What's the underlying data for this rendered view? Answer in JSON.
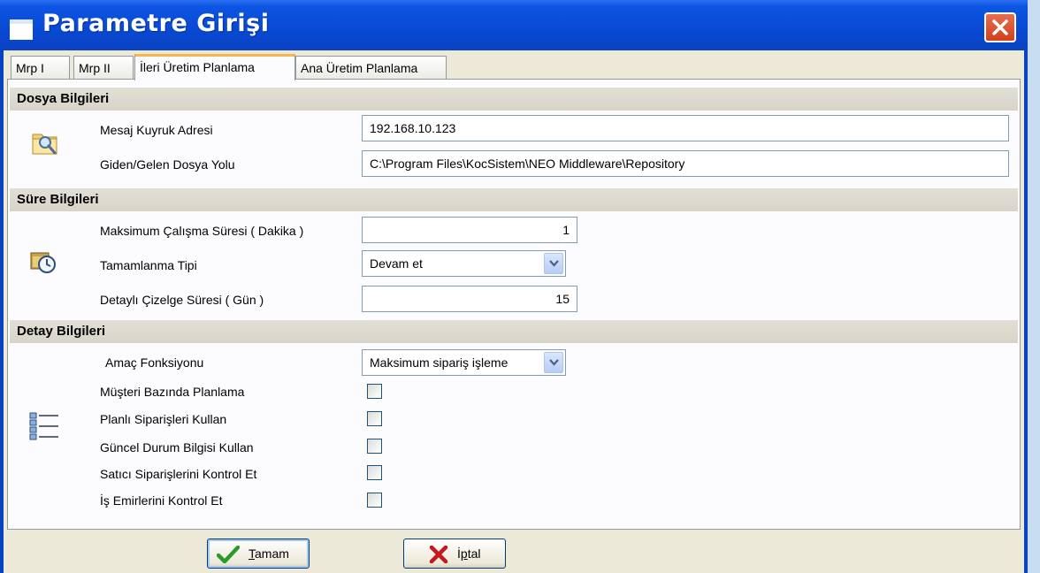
{
  "window": {
    "title": "Parametre Girişi"
  },
  "tabs": [
    "Mrp I",
    "Mrp II",
    "İleri Üretim Planlama",
    "Ana Üretim Planlama"
  ],
  "sections": {
    "dosya": {
      "title": "Dosya Bilgileri",
      "mesaj_label": "Mesaj Kuyruk Adresi",
      "mesaj_value": "192.168.10.123",
      "yol_label": "Giden/Gelen Dosya Yolu",
      "yol_value": "C:\\Program Files\\KocSistem\\NEO Middleware\\Repository"
    },
    "sure": {
      "title": "Süre Bilgileri",
      "maks_label": "Maksimum Çalışma Süresi ( Dakika )",
      "maks_value": "1",
      "tip_label": "Tamamlanma Tipi",
      "tip_value": "Devam et",
      "cizelge_label": "Detaylı Çizelge Süresi ( Gün )",
      "cizelge_value": "15"
    },
    "detay": {
      "title": "Detay Bilgileri",
      "amac_label": "Amaç Fonksiyonu",
      "amac_value": "Maksimum sipariş işleme",
      "checks": [
        "Müşteri Bazında Planlama",
        "Planlı Siparişleri Kullan",
        "Güncel Durum Bilgisi Kullan",
        "Satıcı Siparişlerini Kontrol Et",
        "İş Emirlerini Kontrol Et"
      ]
    }
  },
  "buttons": {
    "ok_hot": "T",
    "ok_rest": "amam",
    "cancel_pre": "İ",
    "cancel_hot": "p",
    "cancel_rest": "tal"
  },
  "colors": {
    "titlebar": "#0a49d4",
    "accent_tab": "#f7b64c",
    "ok_check": "#2d9b2b",
    "cancel_x": "#c8161d"
  }
}
